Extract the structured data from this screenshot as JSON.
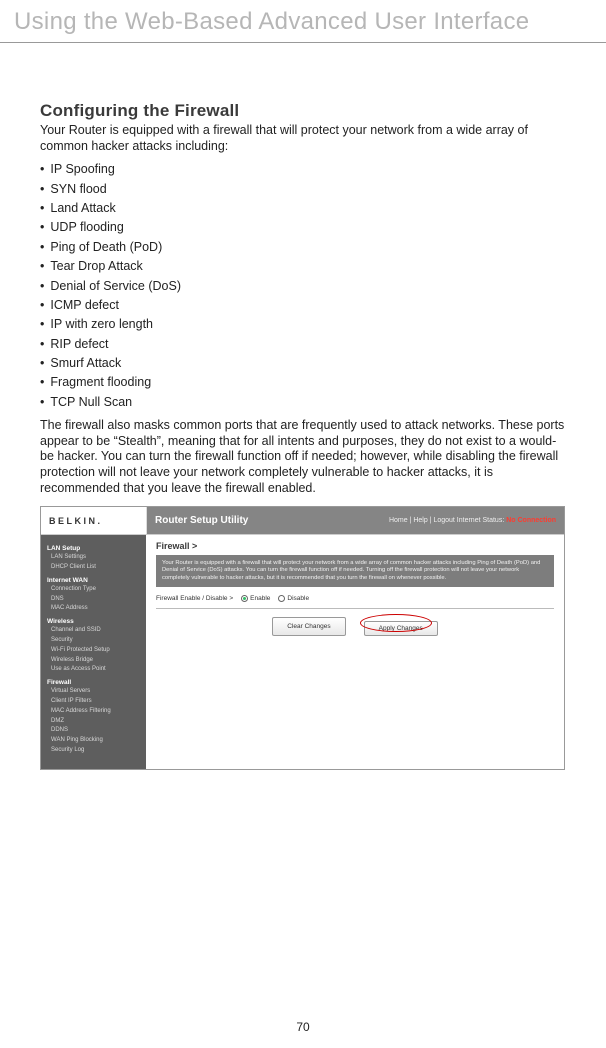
{
  "chapter_title": "Using the Web-Based Advanced User Interface",
  "page_number": "70",
  "section": {
    "heading": "Configuring the Firewall",
    "intro": "Your Router is equipped with a firewall that will protect your network from a wide array of common hacker attacks including:",
    "bullets": [
      "IP Spoofing",
      "SYN flood",
      "Land Attack",
      "UDP flooding",
      "Ping of Death (PoD)",
      "Tear Drop Attack",
      "Denial of Service (DoS)",
      "ICMP defect",
      "IP with zero length",
      "RIP defect",
      "Smurf Attack",
      "Fragment flooding",
      "TCP Null Scan"
    ],
    "outro": "The firewall also masks common ports that are frequently used to attack networks. These ports appear to be “Stealth”, meaning that for all intents and purposes, they do not exist to a would-be hacker. You can turn the firewall function off if needed; however, while disabling the firewall protection will not leave your network completely vulnerable to hacker attacks, it is recommended that you leave the firewall enabled."
  },
  "ui": {
    "logo": "BELKIN.",
    "title": "Router Setup Utility",
    "topnav": "Home | Help | Logout    Internet Status:",
    "status": "No Connection",
    "breadcrumb": "Firewall >",
    "description": "Your Router is equipped with a firewall that will protect your network from a wide array of common hacker attacks including Ping of Death (PoD) and Denial of Service (DoS) attacks. You can turn the firewall function off if needed. Turning off the firewall protection will not leave your network completely vulnerable to hacker attacks, but it is recommended that you turn the firewall on whenever possible.",
    "toggle_label": "Firewall Enable / Disable >",
    "opt_enable": "Enable",
    "opt_disable": "Disable",
    "btn_clear": "Clear Changes",
    "btn_apply": "Apply Changes",
    "sidebar": {
      "g1": "LAN Setup",
      "g1_items": [
        "LAN Settings",
        "DHCP Client List"
      ],
      "g2": "Internet WAN",
      "g2_items": [
        "Connection Type",
        "DNS",
        "MAC Address"
      ],
      "g3": "Wireless",
      "g3_items": [
        "Channel and SSID",
        "Security",
        "Wi-Fi Protected Setup",
        "Wireless Bridge",
        "Use as Access Point"
      ],
      "g4": "Firewall",
      "g4_items": [
        "Virtual Servers",
        "Client IP Filters",
        "MAC Address Filtering",
        "DMZ",
        "DDNS",
        "WAN Ping Blocking",
        "Security Log"
      ]
    }
  }
}
